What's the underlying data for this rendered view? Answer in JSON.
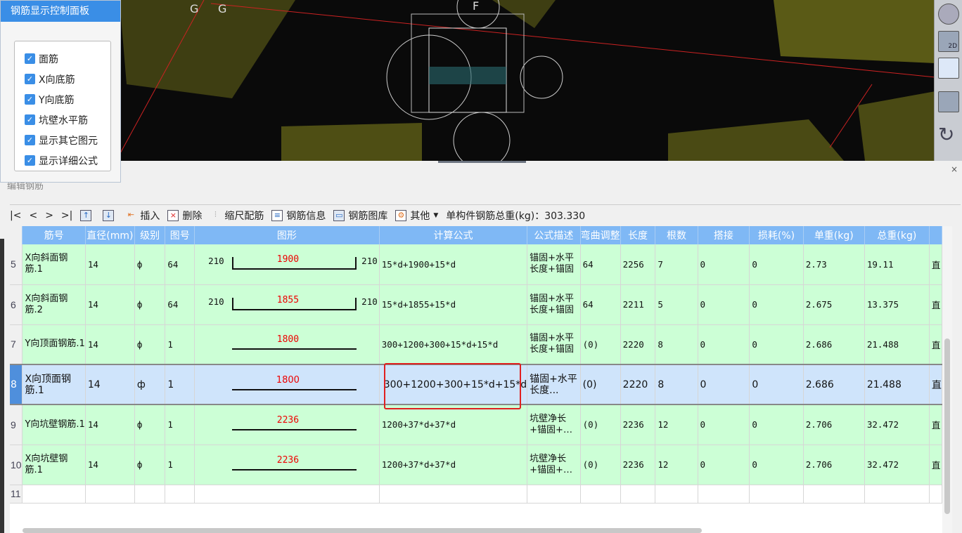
{
  "panel": {
    "title": "钢筋显示控制面板",
    "options": [
      {
        "label": "面筋",
        "checked": true
      },
      {
        "label": "X向底筋",
        "checked": true
      },
      {
        "label": "Y向底筋",
        "checked": true
      },
      {
        "label": "坑壁水平筋",
        "checked": true
      },
      {
        "label": "显示其它图元",
        "checked": true
      },
      {
        "label": "显示详细公式",
        "checked": true
      }
    ]
  },
  "viewport": {
    "axis_labels": [
      "G",
      "G",
      "F"
    ],
    "view_tools": [
      "orbit-icon",
      "2D",
      "view-box-icon",
      "cube-icon",
      "rotate-icon"
    ]
  },
  "bottom": {
    "group_title": "编辑钢筋",
    "close": "×"
  },
  "toolbar": {
    "nav": [
      "|<",
      "<",
      ">",
      ">|"
    ],
    "insert": "插入",
    "delete": "删除",
    "scale": "缩尺配筋",
    "info": "钢筋信息",
    "library": "钢筋图库",
    "other": "其他",
    "total": "单构件钢筋总重(kg)：303.330"
  },
  "columns": [
    "筋号",
    "直径(mm)",
    "级别",
    "图号",
    "图形",
    "计算公式",
    "公式描述",
    "弯曲调整",
    "长度",
    "根数",
    "搭接",
    "损耗(%)",
    "单重(kg)",
    "总重(kg)",
    ""
  ],
  "rows": [
    {
      "no": "5",
      "name": "X向斜面钢筋.1",
      "dia": "14",
      "grade": "ф",
      "fig": "64",
      "shape": {
        "left": "210",
        "mid": "1900",
        "right": "210",
        "type": "u"
      },
      "formula": "15*d+1900+15*d",
      "desc": "锚固+水平长度+锚固",
      "bend": "64",
      "len": "2256",
      "count": "7",
      "lap": "0",
      "loss": "0",
      "unit": "2.73",
      "total": "19.11",
      "extra": "直"
    },
    {
      "no": "6",
      "name": "X向斜面钢筋.2",
      "dia": "14",
      "grade": "ф",
      "fig": "64",
      "shape": {
        "left": "210",
        "mid": "1855",
        "right": "210",
        "type": "u"
      },
      "formula": "15*d+1855+15*d",
      "desc": "锚固+水平长度+锚固",
      "bend": "64",
      "len": "2211",
      "count": "5",
      "lap": "0",
      "loss": "0",
      "unit": "2.675",
      "total": "13.375",
      "extra": "直"
    },
    {
      "no": "7",
      "name": "Y向顶面钢筋.1",
      "dia": "14",
      "grade": "ф",
      "fig": "1",
      "shape": {
        "left": "",
        "mid": "1800",
        "right": "",
        "type": "line"
      },
      "formula": "300+1200+300+15*d+15*d",
      "desc": "锚固+水平长度+锚固",
      "bend": "(0)",
      "len": "2220",
      "count": "8",
      "lap": "0",
      "loss": "0",
      "unit": "2.686",
      "total": "21.488",
      "extra": "直"
    },
    {
      "no": "8",
      "name": "X向顶面钢筋.1",
      "dia": "14",
      "grade": "ф",
      "fig": "1",
      "shape": {
        "left": "",
        "mid": "1800",
        "right": "",
        "type": "line"
      },
      "formula": "300+1200+300+15*d+15*d",
      "desc": "锚固+水平长度...",
      "bend": "(0)",
      "len": "2220",
      "count": "8",
      "lap": "0",
      "loss": "0",
      "unit": "2.686",
      "total": "21.488",
      "extra": "直",
      "selected": true
    },
    {
      "no": "9",
      "name": "Y向坑壁钢筋.1",
      "dia": "14",
      "grade": "ф",
      "fig": "1",
      "shape": {
        "left": "",
        "mid": "2236",
        "right": "",
        "type": "line"
      },
      "formula": "1200+37*d+37*d",
      "desc": "坑壁净长+锚固+…",
      "bend": "(0)",
      "len": "2236",
      "count": "12",
      "lap": "0",
      "loss": "0",
      "unit": "2.706",
      "total": "32.472",
      "extra": "直"
    },
    {
      "no": "10",
      "name": "X向坑壁钢筋.1",
      "dia": "14",
      "grade": "ф",
      "fig": "1",
      "shape": {
        "left": "",
        "mid": "2236",
        "right": "",
        "type": "line"
      },
      "formula": "1200+37*d+37*d",
      "desc": "坑壁净长+锚固+…",
      "bend": "(0)",
      "len": "2236",
      "count": "12",
      "lap": "0",
      "loss": "0",
      "unit": "2.706",
      "total": "32.472",
      "extra": "直"
    }
  ],
  "empty_row": "11",
  "colors": {
    "header": "#7fb8f5",
    "row": "#ccffd6",
    "selected": "#cfe4fb",
    "highlight": "#e02020",
    "panel_title": "#3a8ee6"
  }
}
